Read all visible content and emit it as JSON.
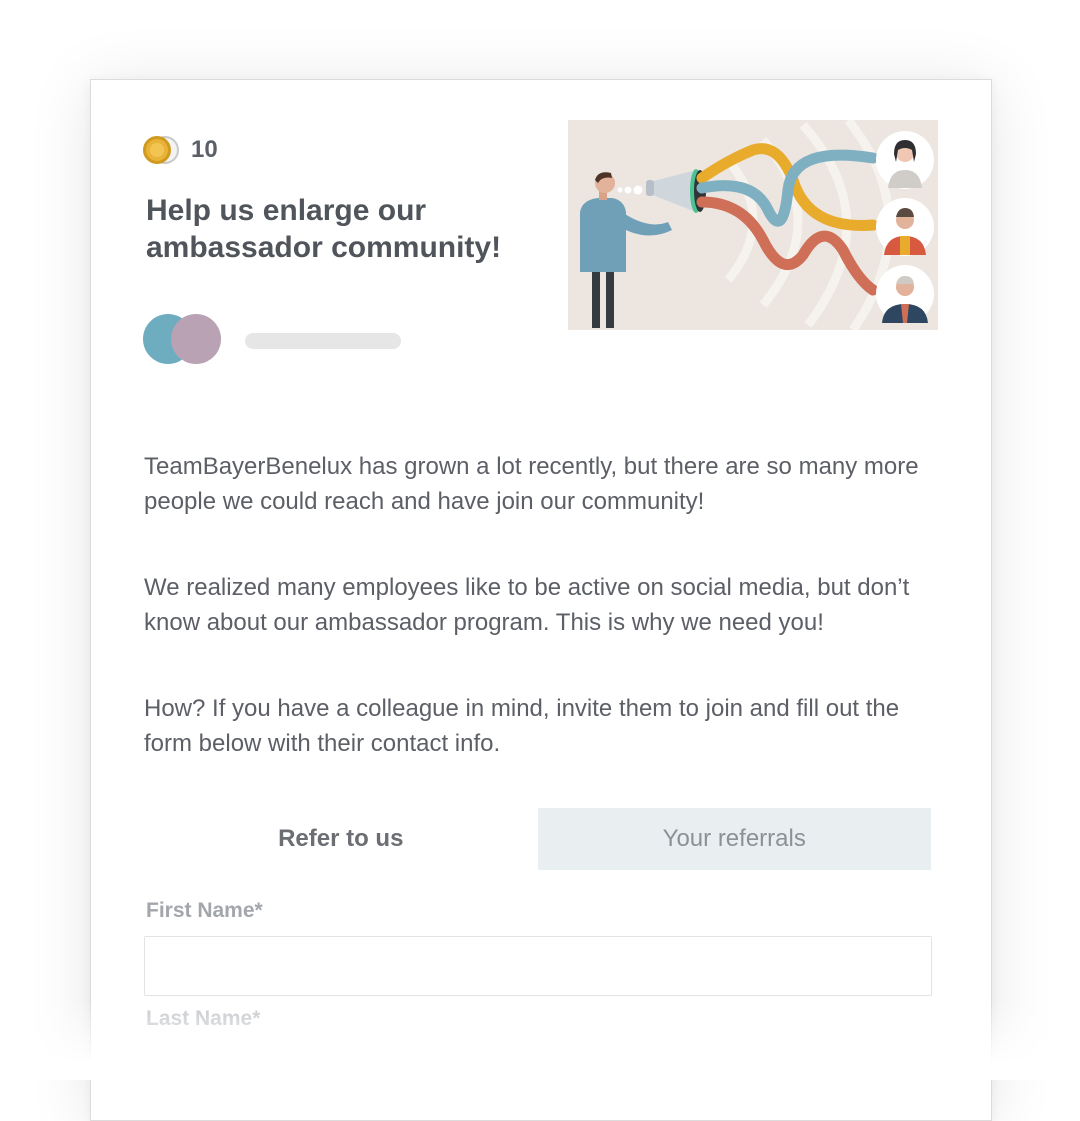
{
  "points": {
    "value": "10",
    "icon": "coin-icon",
    "colors": {
      "coin": "#e9b33a"
    }
  },
  "header": {
    "title": "Help us enlarge our ambassador community!"
  },
  "illustration": {
    "icon": "megaphone-illustration"
  },
  "avatars": {
    "colors": [
      "#6eadc0",
      "#b8a2b4"
    ]
  },
  "body": {
    "paragraphs": [
      "TeamBayerBenelux has grown a lot recently, but there are so many more people we could reach and have join our community!",
      "We realized many employees like to be active on social media, but don’t know about our ambassador program. This is why we need you!",
      "How? If you have a colleague in mind, invite them to join  and fill out the form below with their contact info."
    ]
  },
  "tabs": [
    {
      "label": "Refer to us",
      "active": true
    },
    {
      "label": "Your referrals",
      "active": false
    }
  ],
  "form": {
    "first_name_label": "First Name*",
    "first_name_value": "",
    "last_name_label": "Last Name*"
  }
}
